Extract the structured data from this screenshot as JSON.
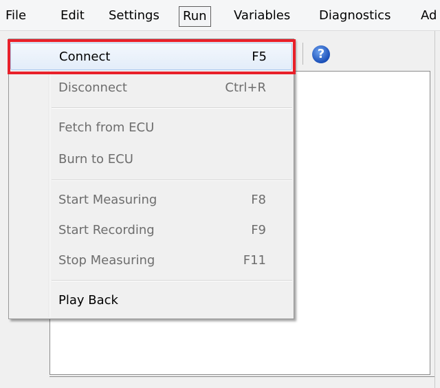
{
  "menubar": {
    "items": [
      {
        "label": "File"
      },
      {
        "label": "Edit"
      },
      {
        "label": "Settings"
      },
      {
        "label": "Run"
      },
      {
        "label": "Variables"
      },
      {
        "label": "Diagnostics"
      },
      {
        "label": "Ad"
      }
    ],
    "active": "Run"
  },
  "toolbar": {
    "help_glyph": "?"
  },
  "run_menu": {
    "items": [
      {
        "label": "Connect",
        "shortcut": "F5",
        "enabled": true,
        "highlighted": true
      },
      {
        "label": "Disconnect",
        "shortcut": "Ctrl+R",
        "enabled": false
      },
      {
        "label": "Fetch from ECU",
        "shortcut": "",
        "enabled": false
      },
      {
        "label": "Burn to ECU",
        "shortcut": "",
        "enabled": false
      },
      {
        "label": "Start Measuring",
        "shortcut": "F8",
        "enabled": false
      },
      {
        "label": "Start Recording",
        "shortcut": "F9",
        "enabled": false
      },
      {
        "label": "Stop Measuring",
        "shortcut": "F11",
        "enabled": false
      },
      {
        "label": "Play Back",
        "shortcut": "",
        "enabled": true
      }
    ]
  },
  "colors": {
    "highlight_box": "#e8202a",
    "disabled_text": "#6d6d6d",
    "help_icon": "#1a4fb8"
  }
}
